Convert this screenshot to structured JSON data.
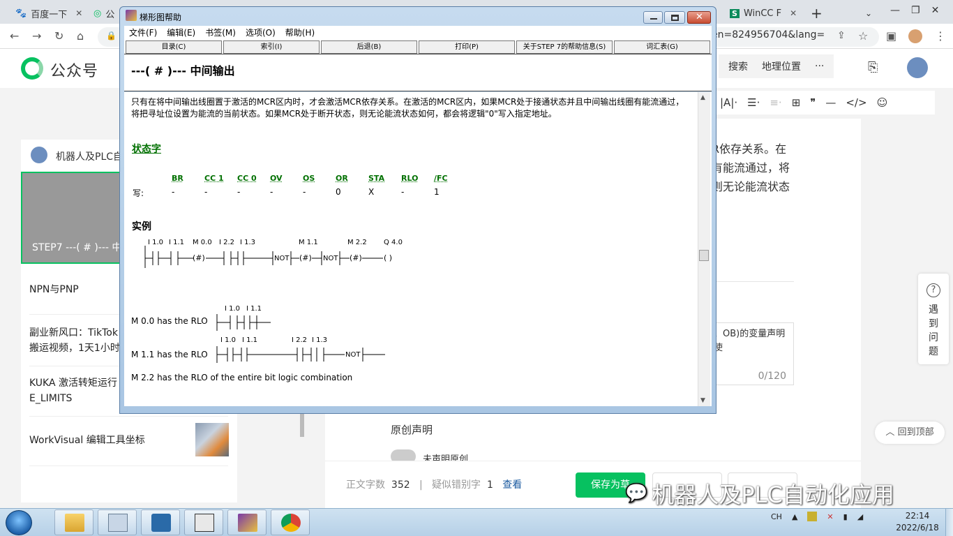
{
  "browser": {
    "tabs": [
      {
        "label": "百度一下",
        "icon": "baidu-paw-icon"
      },
      {
        "label": "公",
        "icon": "wechat-logo-icon"
      },
      {
        "label": "WinCC F",
        "icon": "s-green-icon"
      }
    ],
    "new_tab": "+",
    "url_fragment": "en=824956704&lang="
  },
  "site": {
    "logo_text": "公众号",
    "nav": [
      "搜索",
      "地理位置",
      "···"
    ]
  },
  "left_panel": {
    "account": "机器人及PLC自",
    "active_card": "STEP7 ---( # )--- 中",
    "items": [
      "NPN与PNP",
      "副业新风口：TikTok",
      "搬运视频，1天1小时",
      "KUKA 激活转矩运行",
      "E_LIMITS",
      "WorkVisual 编辑工具坐标"
    ]
  },
  "editor": {
    "right_text": [
      "R依存关系。在",
      "有能流通过，将",
      "则无论能流状态"
    ],
    "declaration_text": [
      "、OB)的变量声明",
      "使"
    ],
    "declaration_count": "0/120",
    "original_label": "原创声明",
    "not_declared": "未声明原创",
    "help_side": [
      "遇",
      "到",
      "问",
      "题"
    ],
    "back_to_top": "回到顶部",
    "word_count_label": "正文字数",
    "word_count": "352",
    "typo_label": "疑似错别字",
    "typo_count": "1",
    "view_link": "查看",
    "save_button": "保存为草",
    "watermark": "机器人及PLC自动化应用"
  },
  "help": {
    "title": "梯形图帮助",
    "menu": [
      "文件(F)",
      "编辑(E)",
      "书签(M)",
      "选项(O)",
      "帮助(H)"
    ],
    "buttons": [
      "目录(C)",
      "索引(I)",
      "后退(B)",
      "打印(P)",
      "关于STEP 7的帮助信息(S)",
      "词汇表(G)"
    ],
    "heading": "---( # )---  中间输出",
    "paragraph": "只有在将中间输出线圈置于激活的MCR区内时，才会激活MCR依存关系。在激活的MCR区内，如果MCR处于接通状态并且中间输出线圈有能流通过，将把寻址位设置为能流的当前状态。如果MCR处于断开状态，则无论能流状态如何，都会将逻辑\"0\"写入指定地址。",
    "status_word_title": "状态字",
    "write_label": "写:",
    "status_bits": [
      {
        "name": "BR",
        "value": "-"
      },
      {
        "name": "CC 1",
        "value": "-"
      },
      {
        "name": "CC 0",
        "value": "-"
      },
      {
        "name": "OV",
        "value": "-"
      },
      {
        "name": "OS",
        "value": "-"
      },
      {
        "name": "OR",
        "value": "0"
      },
      {
        "name": "STA",
        "value": "X"
      },
      {
        "name": "RLO",
        "value": "-"
      },
      {
        "name": "/FC",
        "value": "1"
      }
    ],
    "example_title": "实例",
    "ladder_labels": [
      "I 1.0",
      "I 1.1",
      "M 0.0",
      "I 2.2",
      "I 1.3",
      "M 1.1",
      "M 2.2",
      "Q 4.0"
    ],
    "coil_hash": "(#)",
    "not_label": "NOT",
    "coil_out": "(  )",
    "rlo_lines": [
      "M 0.0 has the RLO",
      "M 1.1 has the RLO",
      "M 2.2 has the RLO of the entire bit logic combination"
    ],
    "rlo1_labels": [
      "I 1.0",
      "I 1.1"
    ],
    "rlo2_labels": [
      "I 1.0",
      "I 1.1",
      "I 2.2",
      "I 1.3"
    ]
  },
  "taskbar": {
    "tray_lang": "CH",
    "time": "22:14",
    "date": "2022/6/18"
  }
}
